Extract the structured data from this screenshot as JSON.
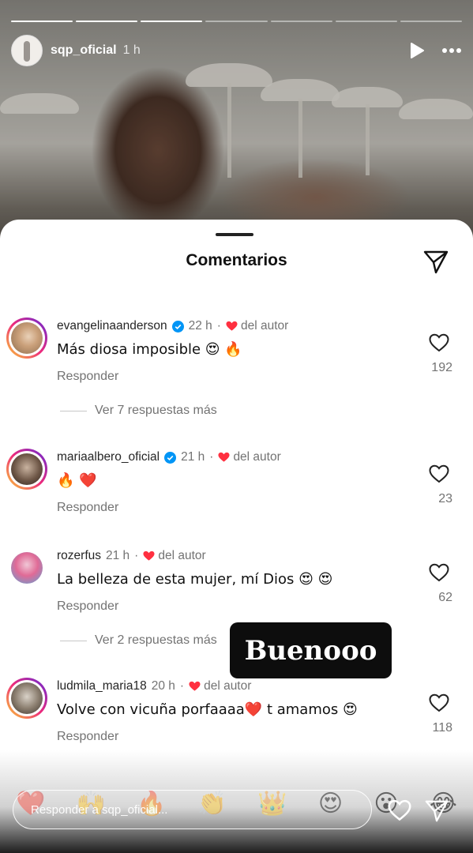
{
  "story": {
    "progress_total": 7,
    "progress_done": 3,
    "username": "sqp_oficial",
    "time": "1 h",
    "play_icon": "play-icon",
    "more_icon": "more-horizontal-icon"
  },
  "sheet": {
    "title": "Comentarios",
    "share_icon": "paper-plane-icon"
  },
  "comments": [
    {
      "username": "evangelinaanderson",
      "verified": true,
      "time": "22 h",
      "liked_by_author": "del autor",
      "text": "Más diosa imposible 😍 🔥",
      "reply_label": "Responder",
      "like_count": "192",
      "more_replies": "Ver 7 respuestas más"
    },
    {
      "username": "mariaalbero_oficial",
      "verified": true,
      "time": "21 h",
      "liked_by_author": "del autor",
      "text": "🔥 ❤️",
      "reply_label": "Responder",
      "like_count": "23"
    },
    {
      "username": "rozerfus",
      "verified": false,
      "time": "21 h",
      "liked_by_author": "del autor",
      "text": "La belleza de esta mujer, mí Dios 😍 😍",
      "reply_label": "Responder",
      "like_count": "62",
      "more_replies": "Ver 2 respuestas más"
    },
    {
      "username": "ludmila_maria18",
      "verified": false,
      "time": "20 h",
      "liked_by_author": "del autor",
      "text": "Volve con vicuña porfaaaa❤️  t amamos 😍",
      "reply_label": "Responder",
      "like_count": "118"
    }
  ],
  "sticker": {
    "text": "Buenooo"
  },
  "bottom_bar": {
    "reply_placeholder": "Responder a sqp_oficial...",
    "quick_reactions": [
      "❤️",
      "🙌",
      "🔥",
      "👏",
      "👑",
      "😍",
      "😮",
      "😂"
    ],
    "like_icon": "heart-outline-icon",
    "send_icon": "paper-plane-icon"
  },
  "colors": {
    "author_heart": "#ff3040",
    "verified_blue": "#0095f6",
    "muted_text": "#737373"
  }
}
